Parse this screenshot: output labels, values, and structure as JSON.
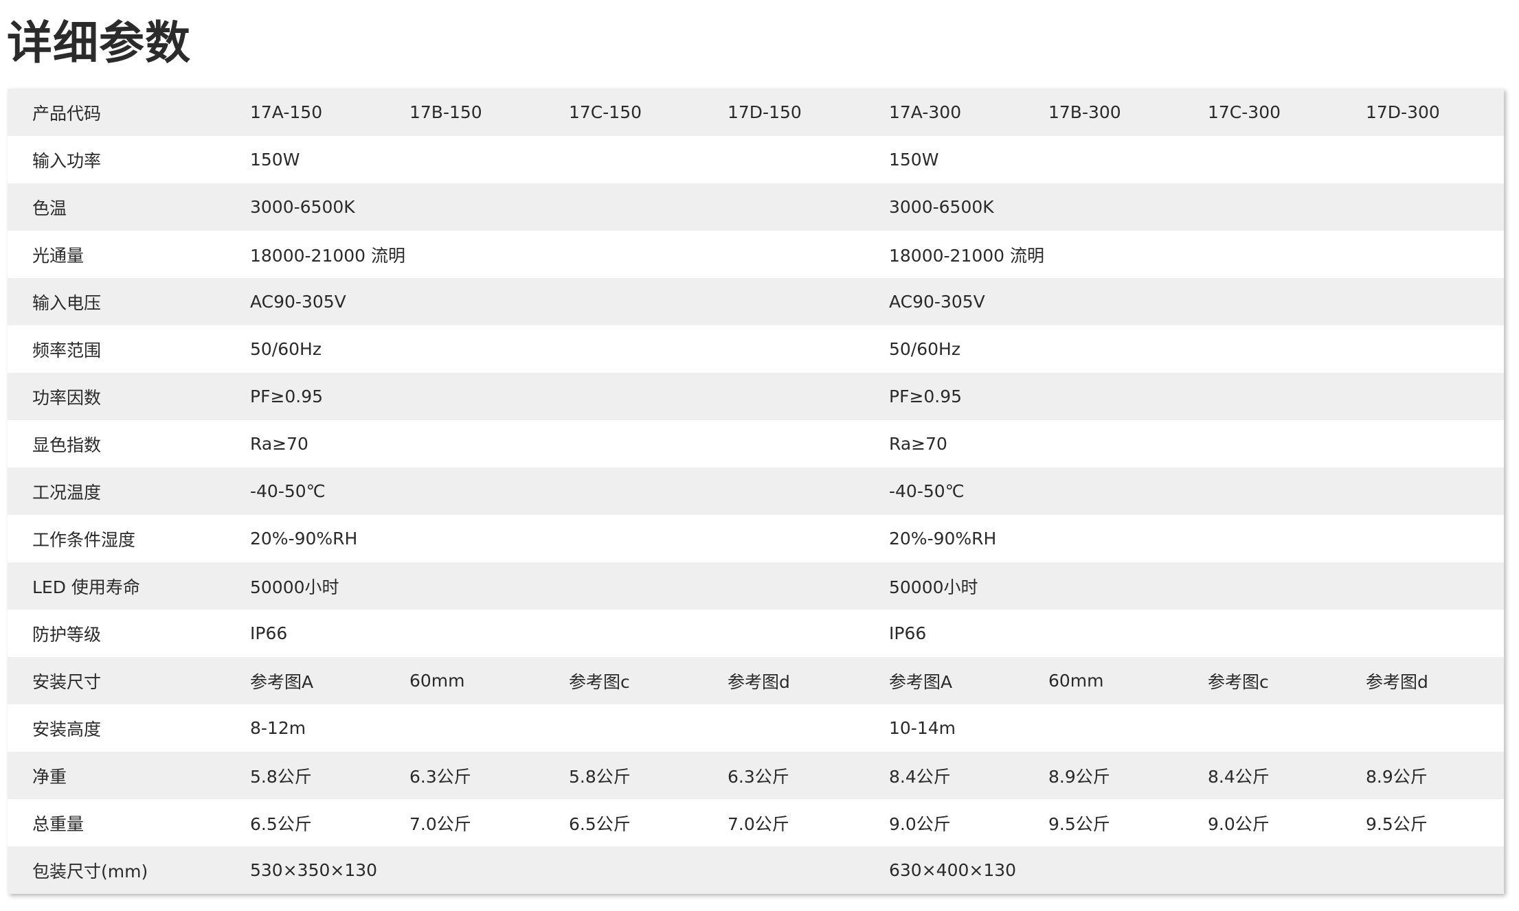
{
  "page": {
    "title": "详细参数"
  },
  "columns": [
    "17A-150",
    "17B-150",
    "17C-150",
    "17D-150",
    "17A-300",
    "17B-300",
    "17C-300",
    "17D-300"
  ],
  "rows": [
    {
      "label": "输入功率",
      "values": [
        "150W",
        "150W"
      ]
    },
    {
      "label": "色温",
      "values": [
        "3000-6500K",
        "3000-6500K"
      ]
    },
    {
      "label": "光通量",
      "values": [
        "18000-21000 流明",
        "18000-21000 流明"
      ]
    },
    {
      "label": "输入电压",
      "values": [
        "AC90-305V",
        "AC90-305V"
      ]
    },
    {
      "label": "频率范围",
      "values": [
        "50/60Hz",
        "50/60Hz"
      ]
    },
    {
      "label": "功率因数",
      "values": [
        "PF≥0.95",
        "PF≥0.95"
      ]
    },
    {
      "label": "显色指数",
      "values": [
        "Ra≥70",
        "Ra≥70"
      ]
    },
    {
      "label": "工况温度",
      "values": [
        "-40-50℃",
        "-40-50℃"
      ]
    },
    {
      "label": "工作条件湿度",
      "values": [
        "20%-90%RH",
        "20%-90%RH"
      ]
    },
    {
      "label": "LED 使用寿命",
      "values": [
        "50000小时",
        "50000小时"
      ]
    },
    {
      "label": "防护等级",
      "values": [
        "IP66",
        "IP66"
      ]
    },
    {
      "label": "安装尺寸",
      "values": [
        "参考图A",
        "60mm",
        "参考图c",
        "参考图d",
        "参考图A",
        "60mm",
        "参考图c",
        "参考图d"
      ]
    },
    {
      "label": "安装高度",
      "values": [
        "8-12m",
        "10-14m"
      ]
    },
    {
      "label": "净重",
      "values": [
        "5.8公斤",
        "6.3公斤",
        "5.8公斤",
        "6.3公斤",
        "8.4公斤",
        "8.9公斤",
        "8.4公斤",
        "8.9公斤"
      ]
    },
    {
      "label": "总重量",
      "values": [
        "6.5公斤",
        "7.0公斤",
        "6.5公斤",
        "7.0公斤",
        "9.0公斤",
        "9.5公斤",
        "9.0公斤",
        "9.5公斤"
      ]
    },
    {
      "label": "包装尺寸(mm)",
      "values": [
        "530×350×130",
        "630×400×130"
      ]
    }
  ],
  "header_label": "产品代码",
  "colors": {
    "stripe": "#efefef",
    "text": "#2a2a2a",
    "title": "#2b2b2b"
  }
}
